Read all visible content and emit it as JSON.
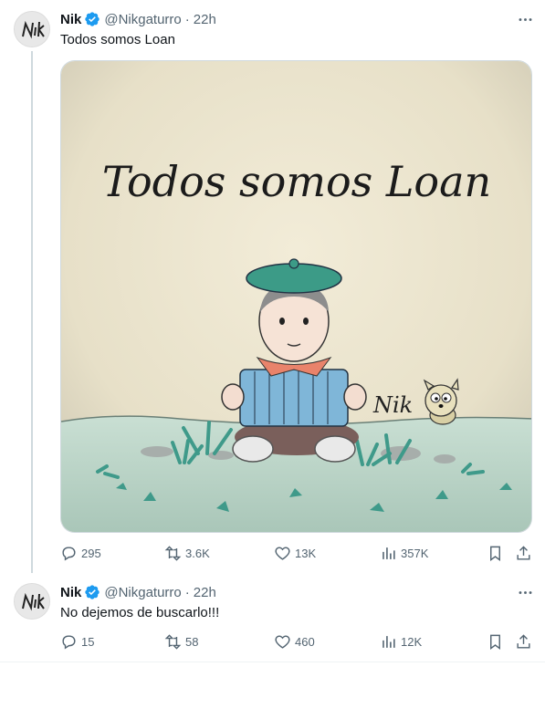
{
  "tweets": [
    {
      "author_name": "Nik",
      "handle": "@Nikgaturro",
      "separator": "·",
      "time": "22h",
      "text": "Todos somos Loan",
      "media": {
        "handwritten_title": "Todos somos Loan",
        "signature": "Nik"
      },
      "stats": {
        "replies": "295",
        "retweets": "3.6K",
        "likes": "13K",
        "views": "357K"
      }
    },
    {
      "author_name": "Nik",
      "handle": "@Nikgaturro",
      "separator": "·",
      "time": "22h",
      "text": "No dejemos de buscarlo!!!",
      "stats": {
        "replies": "15",
        "retweets": "58",
        "likes": "460",
        "views": "12K"
      }
    }
  ],
  "colors": {
    "verified": "#1d9bf0",
    "secondary_text": "#536471",
    "thread_line": "#cfd9de"
  },
  "icons": [
    "more-icon",
    "reply-icon",
    "retweet-icon",
    "like-icon",
    "views-icon",
    "bookmark-icon",
    "share-icon",
    "verified-icon"
  ]
}
